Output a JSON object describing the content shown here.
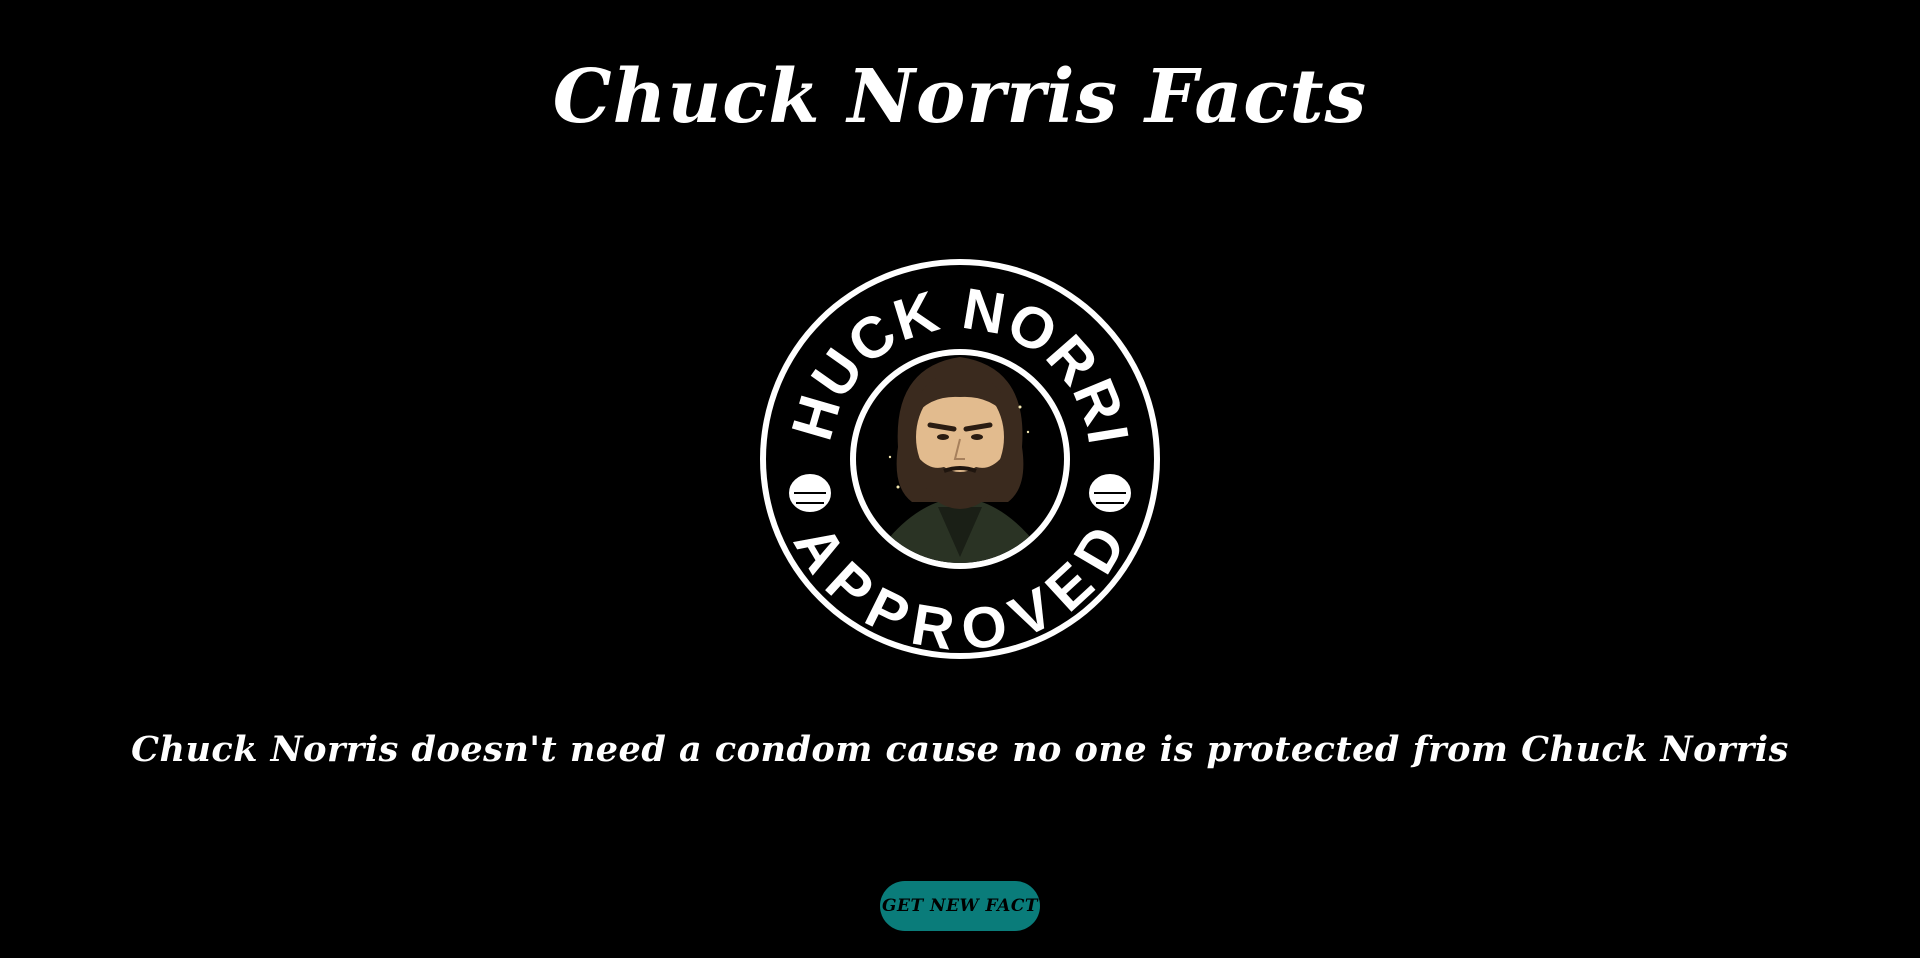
{
  "page": {
    "title": "Chuck Norris Facts",
    "background_color": "#000000",
    "text_color": "#ffffff"
  },
  "badge": {
    "top_text": "CHUCK NORRIS",
    "bottom_text": "APPROVED",
    "icon": "chuck-norris-approved-badge"
  },
  "fact": {
    "text": "Chuck Norris doesn't need a condom cause no one is protected from Chuck Norris"
  },
  "actions": {
    "new_fact_label": "GET NEW FACT",
    "button_color": "#0a7c7a"
  }
}
